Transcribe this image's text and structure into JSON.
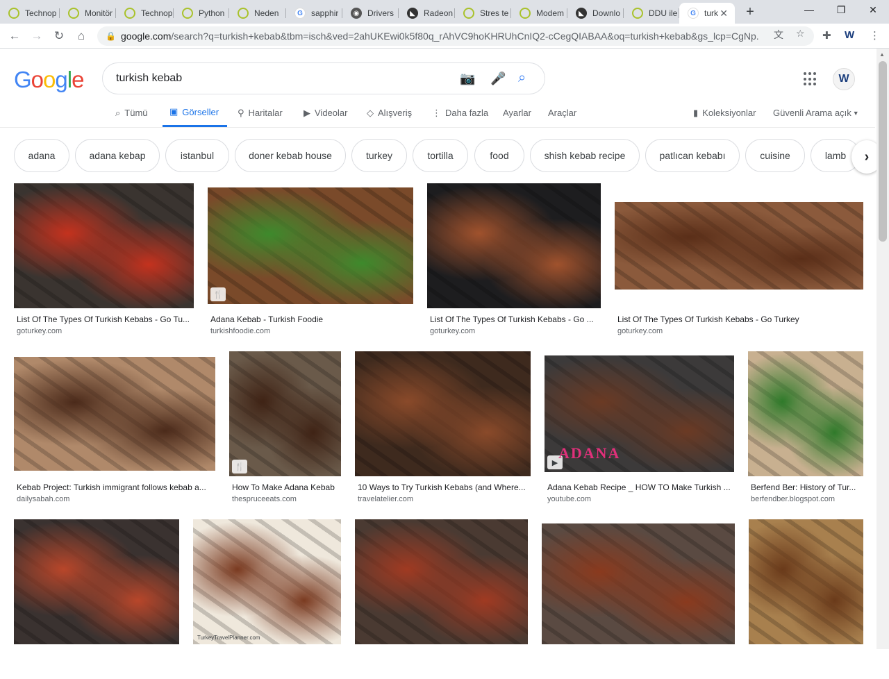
{
  "browser": {
    "tabs": [
      {
        "title": "Technop",
        "fav": "ring"
      },
      {
        "title": "Monitör",
        "fav": "ring"
      },
      {
        "title": "Technop",
        "fav": "ring"
      },
      {
        "title": "Python",
        "fav": "ring"
      },
      {
        "title": "Neden",
        "fav": "ring"
      },
      {
        "title": "sapphir",
        "fav": "g"
      },
      {
        "title": "Drivers",
        "fav": "nv"
      },
      {
        "title": "Radeon",
        "fav": "dark"
      },
      {
        "title": "Stres te",
        "fav": "ring"
      },
      {
        "title": "Modem",
        "fav": "ring"
      },
      {
        "title": "Downlo",
        "fav": "dark"
      },
      {
        "title": "DDU ile",
        "fav": "ring"
      },
      {
        "title": "turk",
        "fav": "g",
        "active": true
      }
    ],
    "new_tab": "+",
    "window_buttons": [
      "—",
      "❐",
      "✕"
    ],
    "url_host": "google.com",
    "url_rest": "/search?q=turkish+kebab&tbm=isch&ved=2ahUKEwi0k5f80q_rAhVC9hoKHRUhCnIQ2-cCegQIABAA&oq=turkish+kebab&gs_lcp=CgNp..."
  },
  "google": {
    "logo": [
      "G",
      "o",
      "o",
      "g",
      "l",
      "e"
    ],
    "query": "turkish kebab",
    "avatar_letter": "W",
    "menu": [
      {
        "label": "Tümü",
        "icon": "search-icon",
        "glyph": "⌕"
      },
      {
        "label": "Görseller",
        "icon": "image-icon",
        "glyph": "▣",
        "active": true
      },
      {
        "label": "Haritalar",
        "icon": "map-pin-icon",
        "glyph": "⚲"
      },
      {
        "label": "Videolar",
        "icon": "play-icon",
        "glyph": "▶"
      },
      {
        "label": "Alışveriş",
        "icon": "tag-icon",
        "glyph": "◇"
      },
      {
        "label": "Daha fazla",
        "icon": "more-vert-icon",
        "glyph": "⋮"
      },
      {
        "label": "Ayarlar",
        "icon": "",
        "glyph": ""
      },
      {
        "label": "Araçlar",
        "icon": "",
        "glyph": ""
      }
    ],
    "collections": "Koleksiyonlar",
    "safe_search": "Güvenli Arama açık"
  },
  "chips": [
    "adana",
    "adana kebap",
    "istanbul",
    "doner kebab house",
    "turkey",
    "tortilla",
    "food",
    "shish kebab recipe",
    "patlıcan kebabı",
    "cuisine",
    "lamb"
  ],
  "results": [
    {
      "title": "List Of The Types Of Turkish Kebabs - Go Tu...",
      "source": "goturkey.com",
      "bg": "#3a3430",
      "accent": "#c4321e",
      "badge": ""
    },
    {
      "title": "Adana Kebab - Turkish Foodie",
      "source": "turkishfoodie.com",
      "bg": "#7a4a2a",
      "accent": "#3e8a2c",
      "badge": "🍴"
    },
    {
      "title": "List Of The Types Of Turkish Kebabs - Go ...",
      "source": "goturkey.com",
      "bg": "#1d1d1f",
      "accent": "#a0522d",
      "badge": ""
    },
    {
      "title": "List Of The Types Of Turkish Kebabs - Go Turkey",
      "source": "goturkey.com",
      "bg": "#8b5a3c",
      "accent": "#5a2e18",
      "badge": ""
    },
    {
      "title": "Kebab Project: Turkish immigrant follows kebab a...",
      "source": "dailysabah.com",
      "bg": "#b0896a",
      "accent": "#4b2a1a",
      "badge": ""
    },
    {
      "title": "How To Make Adana Kebab",
      "source": "thespruceeats.com",
      "bg": "#6a5a4a",
      "accent": "#3f2315",
      "badge": "🍴"
    },
    {
      "title": "10 Ways to Try Turkish Kebabs (and Where...",
      "source": "travelatelier.com",
      "bg": "#3e2a1e",
      "accent": "#8a4a2a",
      "badge": ""
    },
    {
      "title": "Adana Kebab Recipe _ HOW TO Make Turkish ...",
      "source": "youtube.com",
      "bg": "#3c3a3a",
      "accent": "#6b3a24",
      "badge": "▶",
      "overlay": "ADANA"
    },
    {
      "title": "Berfend Ber: History of Tur...",
      "source": "berfendber.blogspot.com",
      "bg": "#c8b090",
      "accent": "#2f7a2a",
      "badge": ""
    },
    {
      "title": "",
      "source": "",
      "bg": "#3a3230",
      "accent": "#b8462a",
      "badge": ""
    },
    {
      "title": "",
      "source": "",
      "bg": "#efe8dc",
      "accent": "#7a3a20",
      "badge": "",
      "watermark": "TurkeyTravelPlanner.com"
    },
    {
      "title": "",
      "source": "",
      "bg": "#4a3a32",
      "accent": "#a03a22",
      "badge": ""
    },
    {
      "title": "",
      "source": "",
      "bg": "#5a4a42",
      "accent": "#8a3a1e",
      "badge": ""
    },
    {
      "title": "",
      "source": "",
      "bg": "#a8804e",
      "accent": "#6a3a1a",
      "badge": ""
    }
  ]
}
